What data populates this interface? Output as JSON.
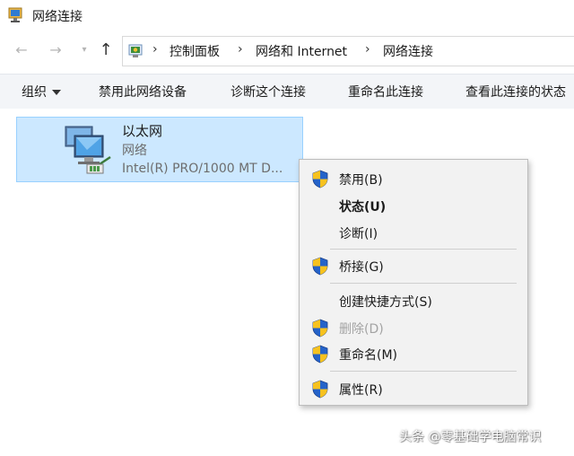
{
  "window": {
    "title": "网络连接"
  },
  "breadcrumb": [
    "控制面板",
    "网络和 Internet",
    "网络连接"
  ],
  "toolbar": {
    "organize": "组织",
    "disable": "禁用此网络设备",
    "diagnose": "诊断这个连接",
    "rename": "重命名此连接",
    "status": "查看此连接的状态"
  },
  "connection": {
    "name": "以太网",
    "type": "网络",
    "device": "Intel(R) PRO/1000 MT D..."
  },
  "context_menu": {
    "items": [
      {
        "label": "禁用(B)",
        "icon": "shield-icon"
      },
      {
        "label": "状态(U)",
        "bold": true
      },
      {
        "label": "诊断(I)"
      },
      {
        "label": "桥接(G)",
        "icon": "shield-icon"
      },
      {
        "label": "创建快捷方式(S)"
      },
      {
        "label": "删除(D)",
        "icon": "shield-icon",
        "disabled": true
      },
      {
        "label": "重命名(M)",
        "icon": "shield-icon"
      },
      {
        "label": "属性(R)",
        "icon": "shield-icon"
      }
    ]
  },
  "watermark": "头条 @零基础学电脑常识",
  "colors": {
    "selection": "#cce8ff",
    "selection_border": "#99d1ff",
    "menu_bg": "#f2f2f2"
  }
}
